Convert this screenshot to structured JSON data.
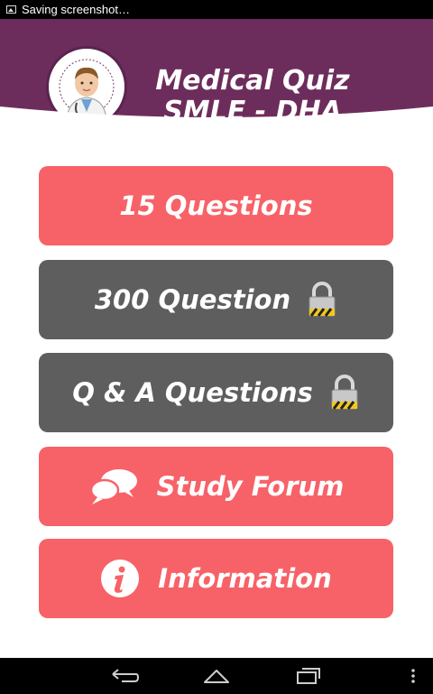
{
  "status_bar": {
    "notification": "Saving screenshot…"
  },
  "header": {
    "title_line1": "Medical Quiz",
    "title_line2": "SMLE - DHA",
    "logo": "doctor-logo"
  },
  "menu": [
    {
      "label": "15 Questions",
      "locked": false,
      "icon": ""
    },
    {
      "label": "300 Question",
      "locked": true,
      "icon": "lock-icon"
    },
    {
      "label": "Q & A Questions",
      "locked": true,
      "icon": "lock-icon"
    },
    {
      "label": "Study Forum",
      "locked": false,
      "icon": "chat-bubbles-icon"
    },
    {
      "label": "Information",
      "locked": false,
      "icon": "info-icon"
    }
  ],
  "nav_bar": {
    "icons": [
      "back-icon",
      "home-icon",
      "recent-apps-icon",
      "menu-dots-icon"
    ]
  },
  "colors": {
    "header": "#6d2d5c",
    "button_red": "#f76268",
    "button_gray": "#5e5e5e"
  }
}
